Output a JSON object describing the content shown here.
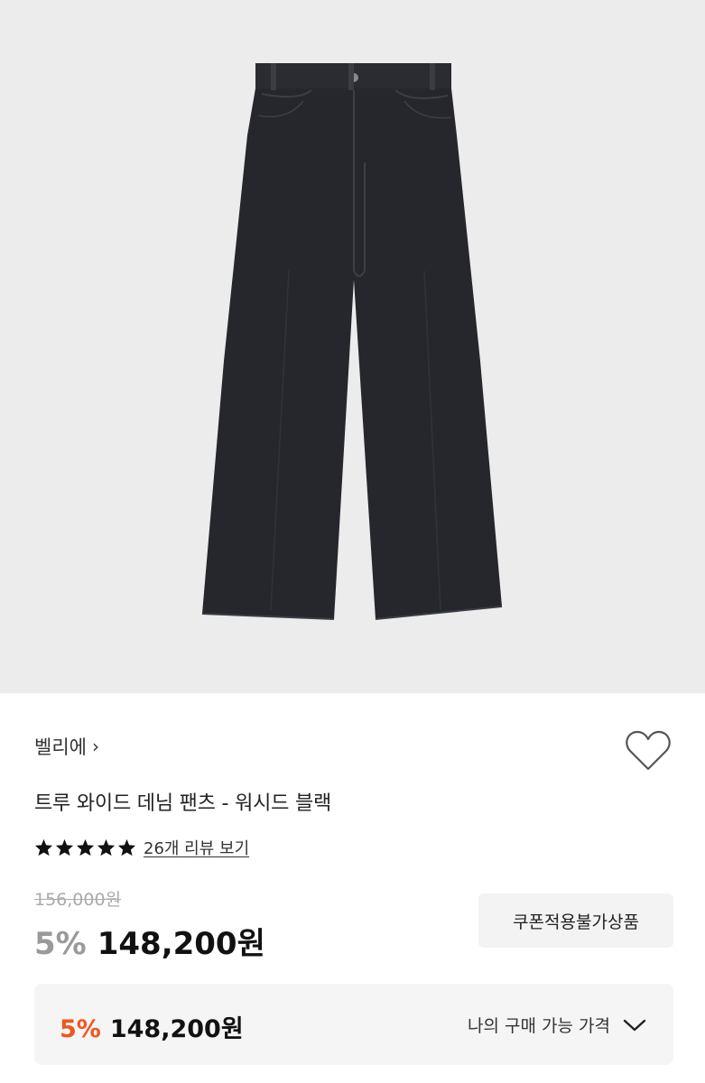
{
  "product": {
    "brand": "벨리에",
    "brand_chevron": "›",
    "title": "트루 와이드 데님 팬츠 - 워시드 블랙",
    "rating_stars": 5,
    "review_link": "26개 리뷰 보기",
    "original_price": "156,000원",
    "discount": "5%",
    "sale_price": "148,200원",
    "coupon_notice": "쿠폰적용불가상품"
  },
  "my_price": {
    "discount": "5%",
    "price": "148,200원",
    "label": "나의 구매 가능 가격",
    "chevron_icon": "chevron-down-icon"
  },
  "icons": {
    "wishlist": "heart-outline-icon",
    "star": "star-icon"
  },
  "colors": {
    "accent_orange": "#f0551e",
    "discount_gray": "#9a9a9a",
    "image_bg": "#ececec",
    "denim": "#24262b"
  }
}
